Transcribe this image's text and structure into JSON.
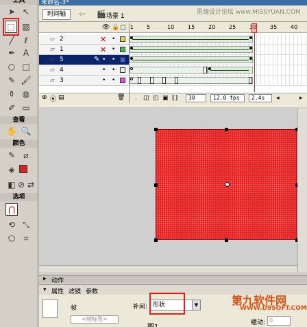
{
  "window": {
    "doc_tab": "未命名-3*",
    "watermark": "思缘设计论坛  www.MISSYUAN.COM"
  },
  "toolbox": {
    "header": "工具",
    "view_label": "查看",
    "colors_label": "颜色",
    "options_label": "选项",
    "stroke_color": "#000000",
    "fill_color": "#e02020"
  },
  "timeline": {
    "tab_label": "时间轴",
    "scene_label": "场景 1",
    "ruler": [
      "1",
      "5",
      "10",
      "15",
      "20",
      "25",
      "30",
      "35",
      "40"
    ],
    "layers": [
      {
        "name": "2",
        "selected": false,
        "color": "#e8d050"
      },
      {
        "name": "1",
        "selected": false,
        "color": "#40c040"
      },
      {
        "name": "5",
        "selected": true,
        "color": "#4060e0"
      },
      {
        "name": "4",
        "selected": false,
        "color": "#e8e8e8"
      },
      {
        "name": "3",
        "selected": false,
        "color": "#e050e0"
      }
    ],
    "footer": {
      "current_frame": "30",
      "fps": "12.0 fps",
      "time": "2.4s"
    }
  },
  "panels": {
    "actions_label": "动作",
    "tabs": [
      "属性",
      "滤镜",
      "参数"
    ],
    "frame_label": "帧",
    "frame_name_placeholder": "<帧标签>",
    "tween_label": "补间:",
    "tween_value": "形状",
    "ease_label": "缓动:",
    "ease_value": "0"
  },
  "brand": {
    "name": "第九软件网",
    "url": "WWW.D9SOFT.COM"
  },
  "caption": "图1"
}
